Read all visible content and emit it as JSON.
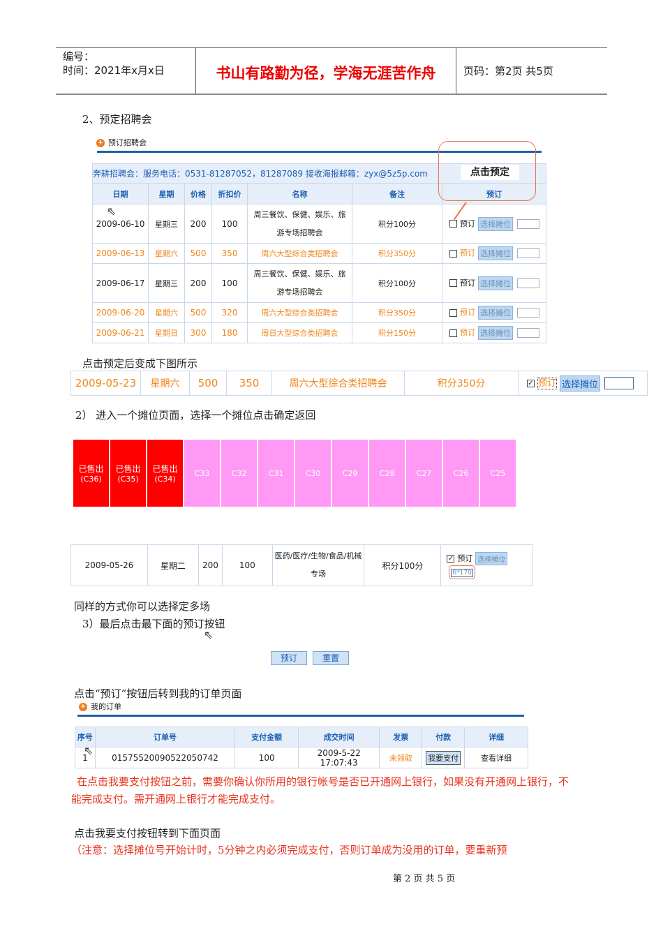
{
  "header": {
    "number_label": "编号：",
    "date_label": "时间：2021年x月x日",
    "motto": "书山有路勤为径，学海无涯苦作舟",
    "page_label": "页码：第2页 共5页"
  },
  "section2_title": "2、预定招聘会",
  "booking_panel": {
    "title": "预订招聘会",
    "info": "奔耕招聘会：服务电话：0531-81287052，81287089  接收海报邮箱：zyx@5z5p.com",
    "callout": "点击预定",
    "columns": [
      "日期",
      "星期",
      "价格",
      "折扣价",
      "名称",
      "备注",
      "预订"
    ],
    "rows": [
      {
        "date": "2009-06-10",
        "weekday": "星期三",
        "price": "200",
        "discount": "100",
        "name": "周三餐饮、保健、娱乐、旅游专场招聘会",
        "note": "积分100分",
        "orange": false
      },
      {
        "date": "2009-06-13",
        "weekday": "星期六",
        "price": "500",
        "discount": "350",
        "name": "周六大型综合类招聘会",
        "note": "积分350分",
        "orange": true
      },
      {
        "date": "2009-06-17",
        "weekday": "星期三",
        "price": "200",
        "discount": "100",
        "name": "周三餐饮、保健、娱乐、旅游专场招聘会",
        "note": "积分100分",
        "orange": false
      },
      {
        "date": "2009-06-20",
        "weekday": "星期六",
        "price": "500",
        "discount": "320",
        "name": "周六大型综合类招聘会",
        "note": "积分350分",
        "orange": true
      },
      {
        "date": "2009-06-21",
        "weekday": "星期日",
        "price": "300",
        "discount": "180",
        "name": "周日大型综合类招聘会",
        "note": "积分150分",
        "orange": true
      }
    ],
    "book_label": "预订",
    "select_label": "选择摊位"
  },
  "after_click_text": "点击预定后变成下图所示",
  "after_row": {
    "date": "2009-05-23",
    "weekday": "星期六",
    "price": "500",
    "discount": "350",
    "name": "周六大型综合类招聘会",
    "note": "积分350分",
    "book_label": "预订",
    "select_label": "选择摊位"
  },
  "step2_text": "2） 进入一个摊位页面，选择一个摊位点击确定返回",
  "booths": [
    {
      "label": "已售出",
      "code": "(C36)",
      "sold": true
    },
    {
      "label": "已售出",
      "code": "(C35)",
      "sold": true
    },
    {
      "label": "已售出",
      "code": "(C34)",
      "sold": true
    },
    {
      "code": "C33",
      "sold": false
    },
    {
      "code": "C32",
      "sold": false
    },
    {
      "code": "C31",
      "sold": false
    },
    {
      "code": "C30",
      "sold": false
    },
    {
      "code": "C29",
      "sold": false
    },
    {
      "code": "C28",
      "sold": false
    },
    {
      "code": "C27",
      "sold": false
    },
    {
      "code": "C26",
      "sold": false
    },
    {
      "code": "C25",
      "sold": false
    }
  ],
  "chosen_row": {
    "date": "2009-05-26",
    "weekday": "星期二",
    "price": "200",
    "discount": "100",
    "name": "医药/医疗/生物/食品/机械专场",
    "note": "积分100分",
    "book_label": "预订",
    "select_label": "选择摊位",
    "booth_value": "6*170"
  },
  "multi_text": "同样的方式你可以选择定多场",
  "step3_text": "3）最后点击最下面的预订按钮",
  "buttons": {
    "book": "预订",
    "reset": "重置"
  },
  "order_intro": "点击“预订”按钮后转到我的订单页面",
  "orders": {
    "title": "我的订单",
    "columns": [
      "序号",
      "订单号",
      "支付金额",
      "成交时间",
      "发票",
      "付款",
      "详细"
    ],
    "row": {
      "index": "1",
      "order_no": "01575520090522050742",
      "amount": "100",
      "time": "2009-5-22 17:07:43",
      "invoice": "未领取",
      "pay": "我要支付",
      "detail": "查看详细"
    }
  },
  "note_bank": "在点击我要支付按钮之前，需要你确认你所用的银行帐号是否已开通网上银行，如果没有开通网上银行，不能完成支付。需开通网上银行才能完成支付。",
  "pay_intro": "点击我要支付按钮转到下面页面",
  "note_timeout": "（注意：选择摊位号开始计时，5分钟之内必须完成支付，否则订单成为没用的订单，要重新预",
  "footer": "第 2 页 共 5 页"
}
